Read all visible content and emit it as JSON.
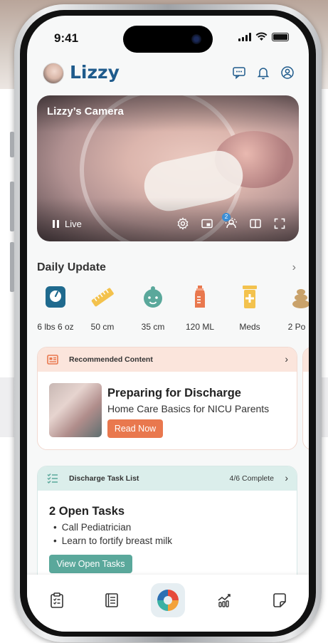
{
  "status_bar": {
    "time": "9:41"
  },
  "header": {
    "title": "Lizzy"
  },
  "camera": {
    "title": "Lizzy’s Camera",
    "live_label": "Live",
    "viewers_badge": "2"
  },
  "daily_update": {
    "title": "Daily Update",
    "items": [
      {
        "label": "6 lbs 6 oz",
        "icon": "scale-icon",
        "color": "#1f6a8e"
      },
      {
        "label": "50 cm",
        "icon": "ruler-icon",
        "color": "#f3c24d"
      },
      {
        "label": "35 cm",
        "icon": "baby-face-icon",
        "color": "#5aa89b"
      },
      {
        "label": "120 ML",
        "icon": "bottle-icon",
        "color": "#e9784e"
      },
      {
        "label": "Meds",
        "icon": "medicine-icon",
        "color": "#f3c24d"
      },
      {
        "label": "2 Po",
        "icon": "diaper-icon",
        "color": "#c9a26b"
      }
    ]
  },
  "recommended": {
    "header": "Recommended Content",
    "title": "Preparing for Discharge",
    "subtitle": "Home Care Basics for NICU Parents",
    "button": "Read Now"
  },
  "tasks": {
    "header": "Discharge Task List",
    "progress": "4/6 Complete",
    "title": "2 Open Tasks",
    "items": [
      "Call Pediatrician",
      "Learn to fortify breast milk"
    ],
    "button": "View Open Tasks"
  },
  "nav": {
    "items": [
      "checklist-icon",
      "book-icon",
      "app-logo-icon",
      "growth-chart-icon",
      "notes-icon"
    ]
  },
  "colors": {
    "brand": "#1f5b8c",
    "accent_orange": "#e9784e",
    "accent_teal": "#5aa89b"
  }
}
